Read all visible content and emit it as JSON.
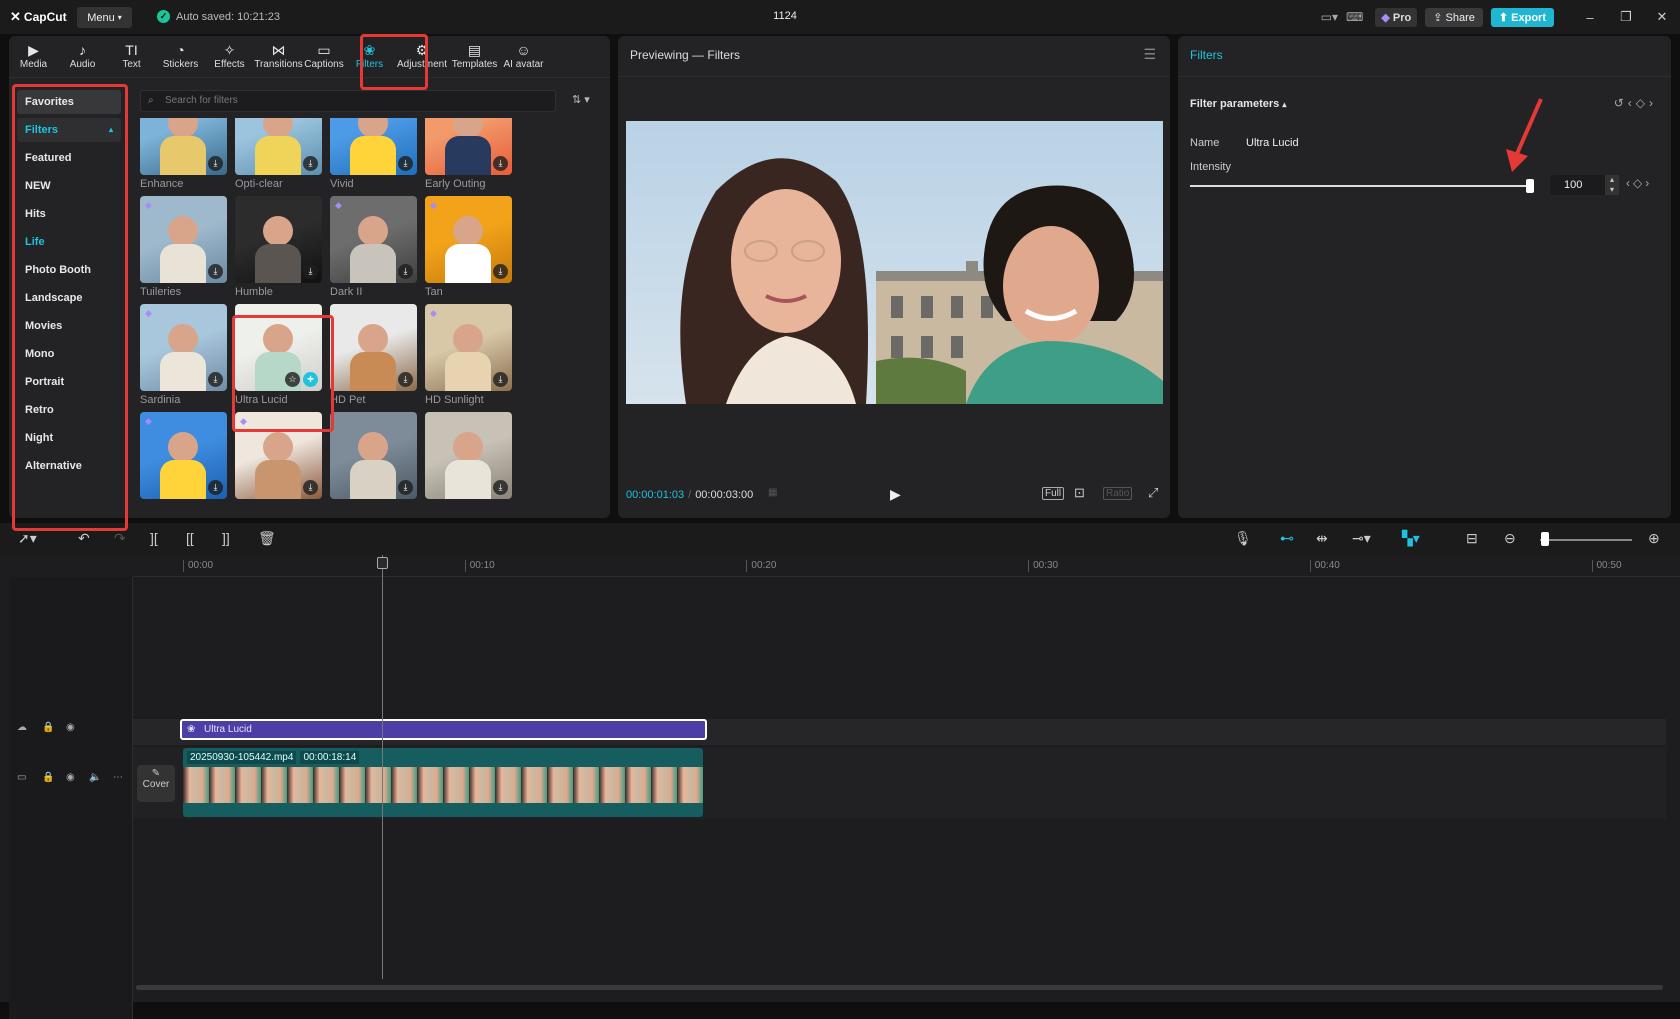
{
  "topbar": {
    "logo": "CapCut",
    "menu_label": "Menu",
    "autosave": "Auto saved: 10:21:23",
    "project_title": "1124",
    "pro_label": "Pro",
    "share_label": "Share",
    "export_label": "Export"
  },
  "library": {
    "tools": [
      {
        "label": "Media",
        "icon": "media-icon",
        "glyph": "▶"
      },
      {
        "label": "Audio",
        "icon": "audio-icon",
        "glyph": "♪"
      },
      {
        "label": "Text",
        "icon": "text-icon",
        "glyph": "TI"
      },
      {
        "label": "Stickers",
        "icon": "stickers-icon",
        "glyph": "◔"
      },
      {
        "label": "Effects",
        "icon": "effects-icon",
        "glyph": "✧"
      },
      {
        "label": "Transitions",
        "icon": "transitions-icon",
        "glyph": "⋈"
      },
      {
        "label": "Captions",
        "icon": "captions-icon",
        "glyph": "▭"
      },
      {
        "label": "Filters",
        "icon": "filters-icon",
        "glyph": "❀"
      },
      {
        "label": "Adjustment",
        "icon": "adjustment-icon",
        "glyph": "⚙"
      },
      {
        "label": "Templates",
        "icon": "templates-icon",
        "glyph": "▤"
      },
      {
        "label": "AI avatar",
        "icon": "ai-avatar-icon",
        "glyph": "☺"
      }
    ],
    "active_tool": "Filters",
    "categories": [
      "Favorites",
      "Filters",
      "Featured",
      "NEW",
      "Hits",
      "Life",
      "Photo Booth",
      "Landscape",
      "Movies",
      "Mono",
      "Portrait",
      "Retro",
      "Night",
      "Alternative"
    ],
    "search_placeholder": "Search for filters",
    "filters": [
      {
        "name": "Enhance",
        "palette": [
          "#7db3d8",
          "#e7c86a",
          "#3a6a8a"
        ],
        "badge": "download",
        "pro": false
      },
      {
        "name": "Opti-clear",
        "palette": [
          "#9cc4de",
          "#f0d45a",
          "#5c8fb0"
        ],
        "badge": "download",
        "pro": false
      },
      {
        "name": "Vivid",
        "palette": [
          "#4d9ae6",
          "#ffd43a",
          "#1f6fb8"
        ],
        "badge": "download",
        "pro": false
      },
      {
        "name": "Early Outing",
        "palette": [
          "#f29a6a",
          "#283a5e",
          "#e85c3a"
        ],
        "badge": "download",
        "pro": false
      },
      {
        "name": "Tuileries",
        "palette": [
          "#9fb9cc",
          "#e9e2d6",
          "#6b8aa3"
        ],
        "badge": "download",
        "pro": true
      },
      {
        "name": "Humble",
        "palette": [
          "#2c2c2c",
          "#5a5550",
          "#111111"
        ],
        "badge": "download",
        "pro": false
      },
      {
        "name": "Dark II",
        "palette": [
          "#6d6d6d",
          "#c9c4bb",
          "#3f3f3f"
        ],
        "badge": "download",
        "pro": true
      },
      {
        "name": "Tan",
        "palette": [
          "#f2a31a",
          "#ffffff",
          "#c57a0a"
        ],
        "badge": "download",
        "pro": true
      },
      {
        "name": "Sardinia",
        "palette": [
          "#a8c6dc",
          "#ece6da",
          "#6f8ea6"
        ],
        "badge": "download",
        "pro": true
      },
      {
        "name": "Ultra Lucid",
        "palette": [
          "#eef0ec",
          "#b6d8c8",
          "#cfcfcb"
        ],
        "badge": "add",
        "pro": false
      },
      {
        "name": "HD Pet",
        "palette": [
          "#e9e9e9",
          "#c98b55",
          "#8a6a4a"
        ],
        "badge": "download",
        "pro": false
      },
      {
        "name": "HD Sunlight",
        "palette": [
          "#d8c8a8",
          "#e8d3b0",
          "#8a7050"
        ],
        "badge": "download",
        "pro": true
      },
      {
        "name": "",
        "palette": [
          "#3f8de0",
          "#ffd43a",
          "#1b5fae"
        ],
        "badge": "download",
        "pro": true
      },
      {
        "name": "",
        "palette": [
          "#efe6de",
          "#c9956e",
          "#8a5a3e"
        ],
        "badge": "download",
        "pro": true
      },
      {
        "name": "",
        "palette": [
          "#7d8c98",
          "#d9d2c4",
          "#4c5a66"
        ],
        "badge": "download",
        "pro": false
      },
      {
        "name": "",
        "palette": [
          "#c8c2b6",
          "#e9e4da",
          "#8a8478"
        ],
        "badge": "download",
        "pro": false
      }
    ]
  },
  "preview": {
    "title": "Previewing — Filters",
    "current_time": "00:00:01:03",
    "duration": "00:00:03:00",
    "full_label": "Full",
    "ratio_label": "Ratio"
  },
  "inspector": {
    "tab": "Filters",
    "section": "Filter parameters",
    "name_label": "Name",
    "name_value": "Ultra Lucid",
    "intensity_label": "Intensity",
    "intensity_value": "100",
    "intensity_fraction": 1.0
  },
  "timeline": {
    "ruler": [
      "00:00",
      "00:10",
      "00:20",
      "00:30",
      "00:40",
      "00:50"
    ],
    "filter_clip": "Ultra Lucid",
    "video_clip_name": "20250930-105442.mp4",
    "video_clip_duration": "00:00:18:14",
    "cover_label": "Cover"
  },
  "colors": {
    "accent": "#1fc3de",
    "highlight": "#e53935",
    "filter_clip": "#4b3fa6",
    "video_clip": "#155d5f"
  }
}
